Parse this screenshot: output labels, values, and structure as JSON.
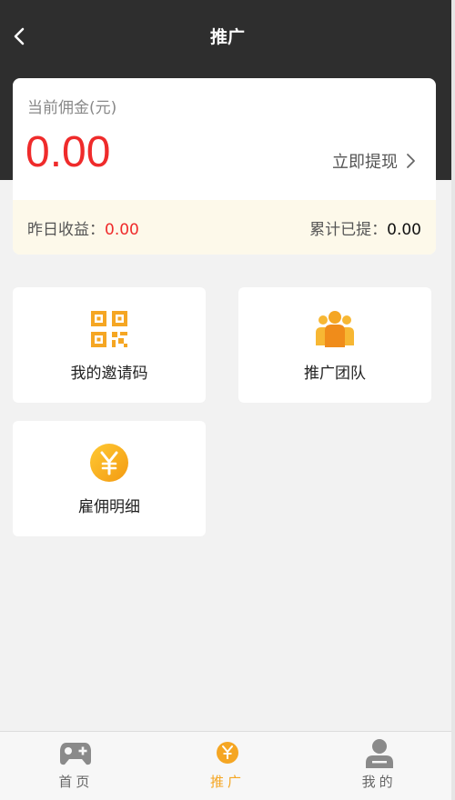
{
  "header": {
    "title": "推广"
  },
  "card": {
    "label": "当前佣金(元)",
    "amount": "0.00",
    "withdraw_label": "立即提现",
    "yesterday_label": "昨日收益：",
    "yesterday_value": "0.00",
    "total_label": "累计已提：",
    "total_value": "0.00"
  },
  "tiles": [
    {
      "label": "我的邀请码",
      "icon": "qr-code-icon"
    },
    {
      "label": "推广团队",
      "icon": "team-icon"
    },
    {
      "label": "雇佣明细",
      "icon": "yen-coin-icon"
    }
  ],
  "tabbar": {
    "items": [
      {
        "label": "首页",
        "icon": "gamepad-icon",
        "active": false
      },
      {
        "label": "推广",
        "icon": "promote-icon",
        "active": true
      },
      {
        "label": "我的",
        "icon": "user-icon",
        "active": false
      }
    ]
  },
  "colors": {
    "accent": "#f5a623",
    "amount_red": "#ef2b2b",
    "header_bg": "#2e2e2e"
  }
}
